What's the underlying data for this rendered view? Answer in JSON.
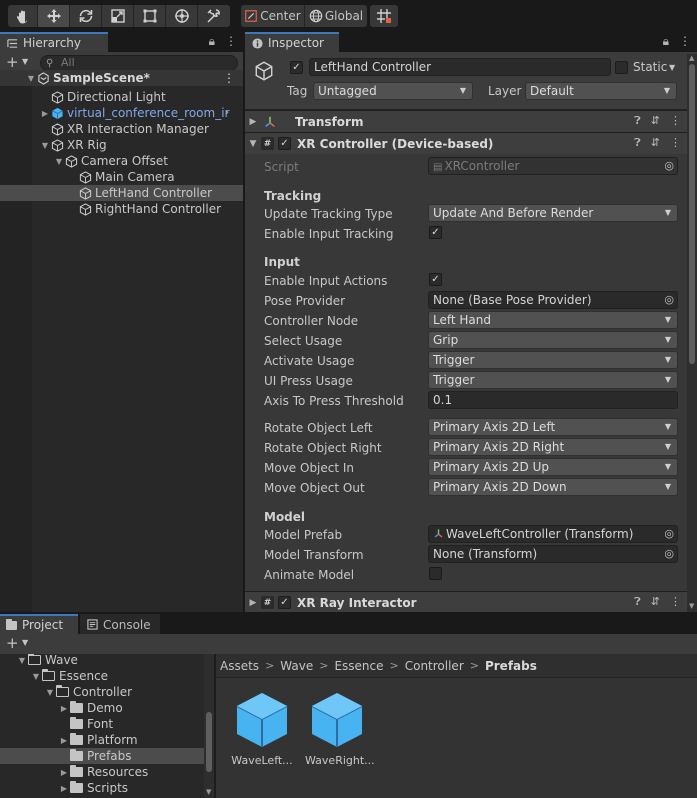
{
  "toolbar": {
    "pivot_label": "Center",
    "space_label": "Global"
  },
  "hierarchy": {
    "tab": "Hierarchy",
    "search_placeholder": "All",
    "items": [
      {
        "label": "SampleScene*",
        "depth": 0,
        "expanded": true,
        "icon": "unity-scene-icon",
        "scene": true
      },
      {
        "label": "Directional Light",
        "depth": 1,
        "icon": "gameobject-cube-icon"
      },
      {
        "label": "virtual_conference_room_ir",
        "depth": 1,
        "icon": "prefab-cube-icon",
        "collapsed": true,
        "prefab": true
      },
      {
        "label": "XR Interaction Manager",
        "depth": 1,
        "icon": "gameobject-cube-icon"
      },
      {
        "label": "XR Rig",
        "depth": 1,
        "icon": "gameobject-cube-icon",
        "expanded": true
      },
      {
        "label": "Camera Offset",
        "depth": 2,
        "icon": "gameobject-cube-icon",
        "expanded": true
      },
      {
        "label": "Main Camera",
        "depth": 3,
        "icon": "gameobject-cube-icon"
      },
      {
        "label": "LeftHand Controller",
        "depth": 3,
        "icon": "gameobject-cube-icon",
        "selected": true
      },
      {
        "label": "RightHand Controller",
        "depth": 3,
        "icon": "gameobject-cube-icon"
      }
    ]
  },
  "inspector": {
    "tab": "Inspector",
    "object_name": "LeftHand Controller",
    "static_label": "Static",
    "tag_label": "Tag",
    "tag_value": "Untagged",
    "layer_label": "Layer",
    "layer_value": "Default",
    "transform_title": "Transform",
    "controller_title": "XR Controller (Device-based)",
    "script_label": "Script",
    "script_value": "XRController",
    "tracking": {
      "title": "Tracking",
      "update_type_label": "Update Tracking Type",
      "update_type_value": "Update And Before Render",
      "enable_tracking_label": "Enable Input Tracking"
    },
    "input": {
      "title": "Input",
      "enable_actions_label": "Enable Input Actions",
      "pose_provider_label": "Pose Provider",
      "pose_provider_value": "None (Base Pose Provider)",
      "controller_node_label": "Controller Node",
      "controller_node_value": "Left Hand",
      "select_usage_label": "Select Usage",
      "select_usage_value": "Grip",
      "activate_usage_label": "Activate Usage",
      "activate_usage_value": "Trigger",
      "ui_press_label": "UI Press Usage",
      "ui_press_value": "Trigger",
      "axis_threshold_label": "Axis To Press Threshold",
      "axis_threshold_value": "0.1",
      "rotate_left_label": "Rotate Object Left",
      "rotate_left_value": "Primary Axis 2D Left",
      "rotate_right_label": "Rotate Object Right",
      "rotate_right_value": "Primary Axis 2D Right",
      "move_in_label": "Move Object In",
      "move_in_value": "Primary Axis 2D Up",
      "move_out_label": "Move Object Out",
      "move_out_value": "Primary Axis 2D Down"
    },
    "model": {
      "title": "Model",
      "prefab_label": "Model Prefab",
      "prefab_value": "WaveLeftController (Transform)",
      "transform_label": "Model Transform",
      "transform_value": "None (Transform)",
      "animate_label": "Animate Model"
    },
    "ray_title": "XR Ray Interactor"
  },
  "project": {
    "tab": "Project",
    "console_tab": "Console",
    "tree": [
      {
        "label": "Wave",
        "depth": 0,
        "open": true
      },
      {
        "label": "Essence",
        "depth": 1,
        "open": true
      },
      {
        "label": "Controller",
        "depth": 2,
        "open": true
      },
      {
        "label": "Demo",
        "depth": 3,
        "collapsed": true
      },
      {
        "label": "Font",
        "depth": 3
      },
      {
        "label": "Platform",
        "depth": 3,
        "collapsed": true
      },
      {
        "label": "Prefabs",
        "depth": 3,
        "selected": true
      },
      {
        "label": "Resources",
        "depth": 3,
        "collapsed": true
      },
      {
        "label": "Scripts",
        "depth": 3,
        "collapsed": true
      }
    ],
    "breadcrumbs": [
      "Assets",
      "Wave",
      "Essence",
      "Controller",
      "Prefabs"
    ],
    "assets": [
      {
        "label": "WaveLeft..."
      },
      {
        "label": "WaveRight..."
      }
    ]
  },
  "colors": {
    "accent": "#3a79bb",
    "prefab_blue": "#7fa8ea",
    "prefab_cube": "#47b3f0"
  }
}
